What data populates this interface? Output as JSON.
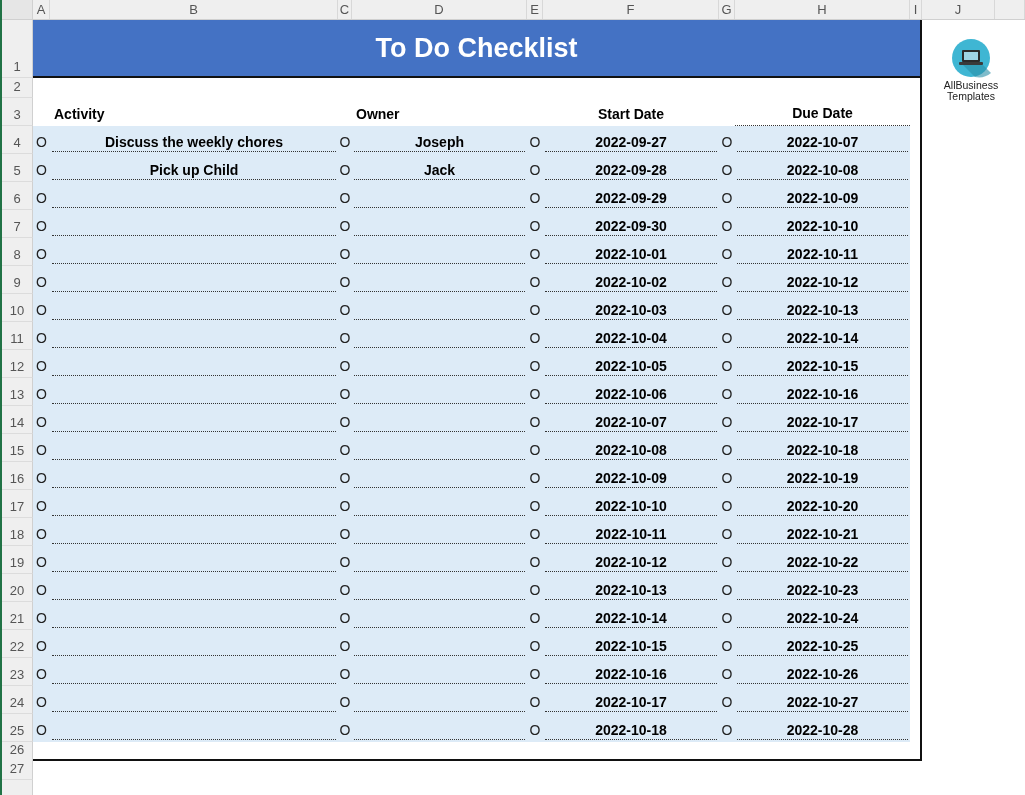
{
  "column_letters": [
    "A",
    "B",
    "C",
    "D",
    "E",
    "F",
    "G",
    "H",
    "I",
    "J"
  ],
  "row_numbers": [
    "1",
    "2",
    "3",
    "4",
    "5",
    "6",
    "7",
    "8",
    "9",
    "10",
    "11",
    "12",
    "13",
    "14",
    "15",
    "16",
    "17",
    "18",
    "19",
    "20",
    "21",
    "22",
    "23",
    "24",
    "25",
    "26",
    "27"
  ],
  "title": "To Do Checklist",
  "logo": {
    "lines": [
      "AllBusiness",
      "Templates"
    ]
  },
  "headers": {
    "activity": "Activity",
    "owner": "Owner",
    "start_date": "Start Date",
    "due_date": "Due Date"
  },
  "tasks": [
    {
      "marks": [
        "O",
        "O",
        "O",
        "O"
      ],
      "activity": "Discuss the weekly chores",
      "owner": "Joseph",
      "start_date": "2022-09-27",
      "due_date": "2022-10-07"
    },
    {
      "marks": [
        "O",
        "O",
        "O",
        "O"
      ],
      "activity": "Pick up Child",
      "owner": "Jack",
      "start_date": "2022-09-28",
      "due_date": "2022-10-08"
    },
    {
      "marks": [
        "O",
        "O",
        "O",
        "O"
      ],
      "start_date": "2022-09-29",
      "due_date": "2022-10-09"
    },
    {
      "marks": [
        "O",
        "O",
        "O",
        "O"
      ],
      "start_date": "2022-09-30",
      "due_date": "2022-10-10"
    },
    {
      "marks": [
        "O",
        "O",
        "O",
        "O"
      ],
      "start_date": "2022-10-01",
      "due_date": "2022-10-11"
    },
    {
      "marks": [
        "O",
        "O",
        "O",
        "O"
      ],
      "start_date": "2022-10-02",
      "due_date": "2022-10-12"
    },
    {
      "marks": [
        "O",
        "O",
        "O",
        "O"
      ],
      "start_date": "2022-10-03",
      "due_date": "2022-10-13"
    },
    {
      "marks": [
        "O",
        "O",
        "O",
        "O"
      ],
      "start_date": "2022-10-04",
      "due_date": "2022-10-14"
    },
    {
      "marks": [
        "O",
        "O",
        "O",
        "O"
      ],
      "start_date": "2022-10-05",
      "due_date": "2022-10-15"
    },
    {
      "marks": [
        "O",
        "O",
        "O",
        "O"
      ],
      "start_date": "2022-10-06",
      "due_date": "2022-10-16"
    },
    {
      "marks": [
        "O",
        "O",
        "O",
        "O"
      ],
      "start_date": "2022-10-07",
      "due_date": "2022-10-17"
    },
    {
      "marks": [
        "O",
        "O",
        "O",
        "O"
      ],
      "start_date": "2022-10-08",
      "due_date": "2022-10-18"
    },
    {
      "marks": [
        "O",
        "O",
        "O",
        "O"
      ],
      "start_date": "2022-10-09",
      "due_date": "2022-10-19"
    },
    {
      "marks": [
        "O",
        "O",
        "O",
        "O"
      ],
      "start_date": "2022-10-10",
      "due_date": "2022-10-20"
    },
    {
      "marks": [
        "O",
        "O",
        "O",
        "O"
      ],
      "start_date": "2022-10-11",
      "due_date": "2022-10-21"
    },
    {
      "marks": [
        "O",
        "O",
        "O",
        "O"
      ],
      "start_date": "2022-10-12",
      "due_date": "2022-10-22"
    },
    {
      "marks": [
        "O",
        "O",
        "O",
        "O"
      ],
      "start_date": "2022-10-13",
      "due_date": "2022-10-23"
    },
    {
      "marks": [
        "O",
        "O",
        "O",
        "O"
      ],
      "start_date": "2022-10-14",
      "due_date": "2022-10-24"
    },
    {
      "marks": [
        "O",
        "O",
        "O",
        "O"
      ],
      "start_date": "2022-10-15",
      "due_date": "2022-10-25"
    },
    {
      "marks": [
        "O",
        "O",
        "O",
        "O"
      ],
      "start_date": "2022-10-16",
      "due_date": "2022-10-26"
    },
    {
      "marks": [
        "O",
        "O",
        "O",
        "O"
      ],
      "start_date": "2022-10-17",
      "due_date": "2022-10-27"
    },
    {
      "marks": [
        "O",
        "O",
        "O",
        "O"
      ],
      "start_date": "2022-10-18",
      "due_date": "2022-10-28"
    }
  ]
}
